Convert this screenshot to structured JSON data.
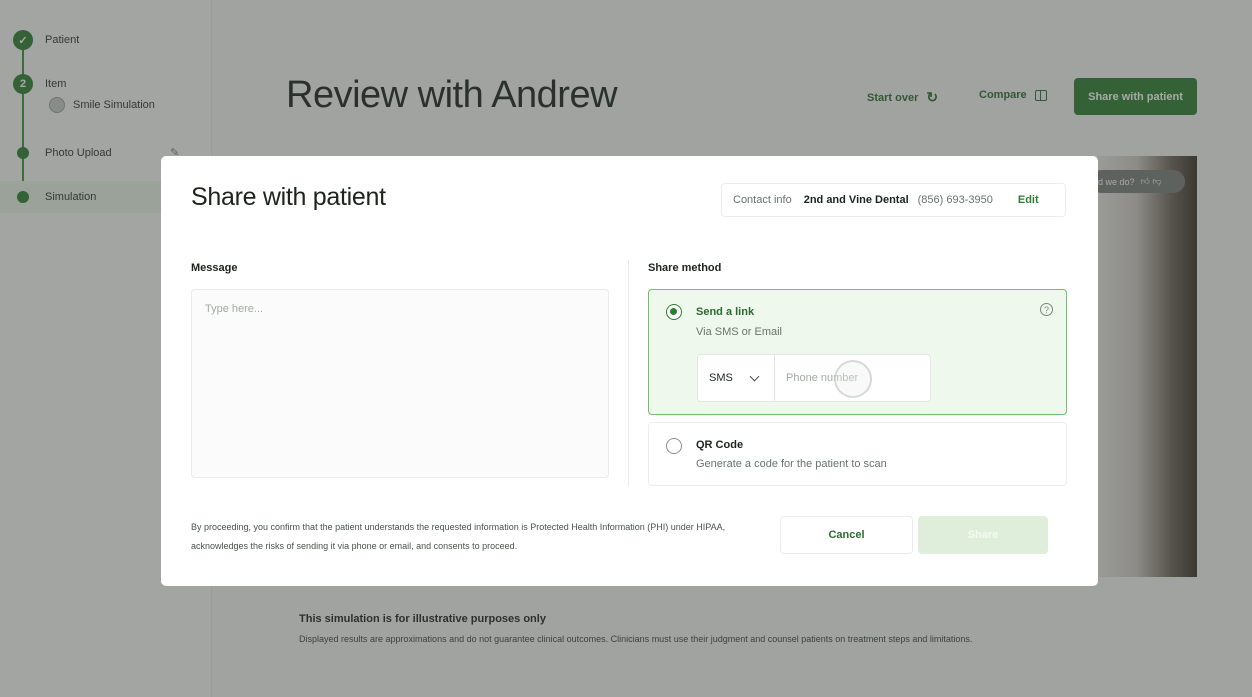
{
  "sidebar": {
    "steps": [
      {
        "label": "Patient",
        "state": "done"
      },
      {
        "label": "Item",
        "number": "2",
        "state": "current"
      },
      {
        "label": "Photo Upload",
        "state": "pending"
      },
      {
        "label": "Simulation",
        "state": "active"
      }
    ],
    "sub_item": "Smile Simulation",
    "edit_icon": "pencil-icon"
  },
  "header": {
    "title": "Review with Andrew",
    "start_over": "Start over",
    "compare": "Compare",
    "share_button": "Share with patient"
  },
  "preview": {
    "feedback_text": "d we do?"
  },
  "footer_notice": {
    "title": "This simulation is for illustrative purposes only",
    "text": "Displayed results are approximations and do not guarantee clinical outcomes. Clinicians must use their judgment and counsel patients on treatment steps and limitations."
  },
  "modal": {
    "title": "Share with patient",
    "contact": {
      "label": "Contact info",
      "name": "2nd and Vine Dental",
      "phone": "(856) 693-3950",
      "edit": "Edit"
    },
    "message_label": "Message",
    "message_placeholder": "Type here...",
    "share_method_label": "Share method",
    "methods": [
      {
        "title": "Send a link",
        "subtitle": "Via SMS or Email",
        "selected": true
      },
      {
        "title": "QR Code",
        "subtitle": "Generate a code for the patient to scan",
        "selected": false
      }
    ],
    "channel": "SMS",
    "phone_placeholder": "Phone number",
    "legal": "By proceeding, you confirm that the patient understands the requested information is Protected Health Information (PHI) under HIPAA, acknowledges the risks of sending it via phone or email, and consents to proceed.",
    "cancel": "Cancel",
    "share": "Share"
  },
  "colors": {
    "accent": "#2e7d32",
    "selected_bg": "#eff8ec",
    "selected_border": "#6fbf6f"
  }
}
